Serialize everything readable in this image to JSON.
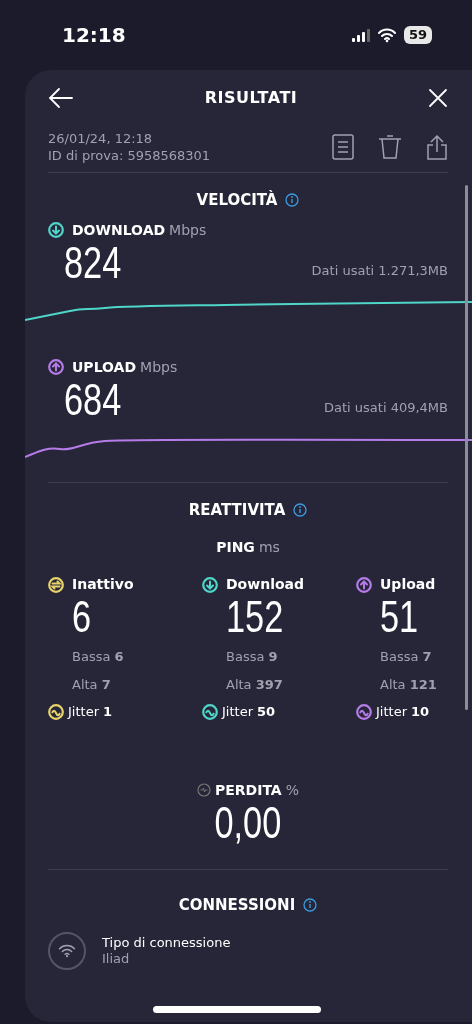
{
  "status_bar": {
    "time": "12:18",
    "battery": "59"
  },
  "header": {
    "title": "RISULTATI",
    "date": "26/01/24, 12:18",
    "test_id": "ID di prova: 5958568301"
  },
  "speed": {
    "title": "VELOCITÀ",
    "metrics": [
      {
        "kind": "download",
        "label": "DOWNLOAD",
        "unit": "Mbps",
        "value": "824",
        "data_used": "Dati usati 1.271,3MB",
        "color": "#4fd6c8"
      },
      {
        "kind": "upload",
        "label": "UPLOAD",
        "unit": "Mbps",
        "value": "684",
        "data_used": "Dati usati 409,4MB",
        "color": "#b57be8"
      }
    ]
  },
  "responsiveness": {
    "title": "REATTIVITA",
    "ping_label": "PING",
    "ping_unit": "ms",
    "columns": [
      {
        "kind": "idle",
        "label": "Inattivo",
        "color": "#e6d36a",
        "value": "6",
        "low_label": "Bassa",
        "low": "6",
        "high_label": "Alta",
        "high": "7",
        "jitter_label": "Jitter",
        "jitter": "1"
      },
      {
        "kind": "download",
        "label": "Download",
        "color": "#4fd6c8",
        "value": "152",
        "low_label": "Bassa",
        "low": "9",
        "high_label": "Alta",
        "high": "397",
        "jitter_label": "Jitter",
        "jitter": "50"
      },
      {
        "kind": "upload",
        "label": "Upload",
        "color": "#b57be8",
        "value": "51",
        "low_label": "Bassa",
        "low": "7",
        "high_label": "Alta",
        "high": "121",
        "jitter_label": "Jitter",
        "jitter": "10"
      }
    ]
  },
  "loss": {
    "label": "PERDITA",
    "unit": "%",
    "value": "0,00"
  },
  "connections": {
    "title": "CONNESSIONI",
    "items": [
      {
        "label": "Tipo di connessione",
        "value": "Iliad"
      }
    ]
  }
}
